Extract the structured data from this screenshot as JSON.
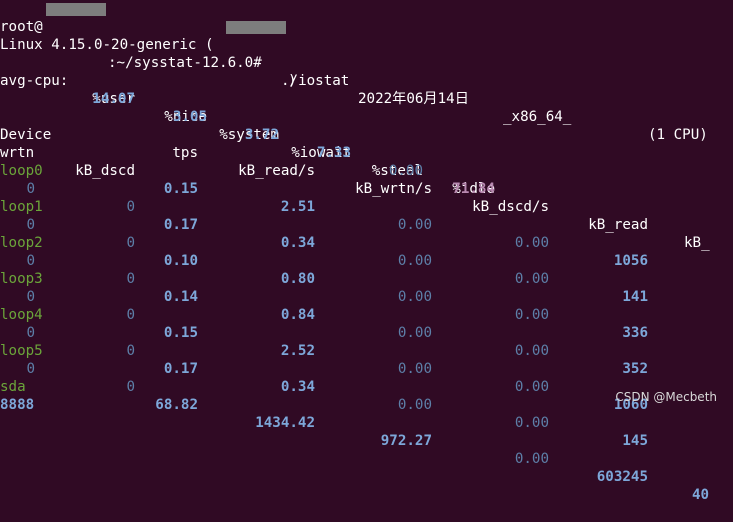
{
  "prompt": {
    "user": "root@",
    "path": ":~/sysstat-12.6.0#",
    "command": "./iostat"
  },
  "sysinfo": {
    "kernel": "Linux 4.15.0-20-generic (",
    "close_paren": ")",
    "date": "2022年06月14日",
    "arch": "_x86_64_",
    "cpus": "(1 CPU)"
  },
  "avgcpu": {
    "label": "avg-cpu:",
    "headers": [
      "%user",
      "%nice",
      "%system",
      "%iowait",
      "%steal",
      "%idle"
    ],
    "values": [
      "14.07",
      "3.05",
      "3.72",
      "7.33",
      "0.00",
      "71.84"
    ]
  },
  "device": {
    "headers_line1": [
      "Device",
      "tps",
      "kB_read/s",
      "kB_wrtn/s",
      "kB_dscd/s",
      "kB_read",
      "kB_"
    ],
    "headers_line2": [
      "wrtn",
      "kB_dscd"
    ],
    "rows": [
      {
        "name": "loop0",
        "tps": "0.15",
        "read_s": "2.51",
        "wrtn_s": "0.00",
        "dscd_s": "0.00",
        "read": "1056",
        "wrtn_cont": "0",
        "dscd": "0"
      },
      {
        "name": "loop1",
        "tps": "0.17",
        "read_s": "0.34",
        "wrtn_s": "0.00",
        "dscd_s": "0.00",
        "read": "141",
        "wrtn_cont": "0",
        "dscd": "0"
      },
      {
        "name": "loop2",
        "tps": "0.10",
        "read_s": "0.80",
        "wrtn_s": "0.00",
        "dscd_s": "0.00",
        "read": "336",
        "wrtn_cont": "0",
        "dscd": "0"
      },
      {
        "name": "loop3",
        "tps": "0.14",
        "read_s": "0.84",
        "wrtn_s": "0.00",
        "dscd_s": "0.00",
        "read": "352",
        "wrtn_cont": "0",
        "dscd": "0"
      },
      {
        "name": "loop4",
        "tps": "0.15",
        "read_s": "2.52",
        "wrtn_s": "0.00",
        "dscd_s": "0.00",
        "read": "1060",
        "wrtn_cont": "0",
        "dscd": "0"
      },
      {
        "name": "loop5",
        "tps": "0.17",
        "read_s": "0.34",
        "wrtn_s": "0.00",
        "dscd_s": "0.00",
        "read": "145",
        "wrtn_cont": "0",
        "dscd": "0"
      },
      {
        "name": "sda",
        "tps": "68.82",
        "read_s": "1434.42",
        "wrtn_s": "972.27",
        "dscd_s": "0.00",
        "read": "603245",
        "wrtn_head": "40",
        "wrtn_cont": "8888",
        "dscd": ""
      }
    ]
  },
  "watermark": "CSDN @Mecbeth",
  "colors": {
    "background": "#300a24",
    "value_blue": "#7da7d9",
    "dim_blue": "#5d7fa8",
    "device_green": "#6ba53a",
    "idle_pink": "#b889b0"
  }
}
